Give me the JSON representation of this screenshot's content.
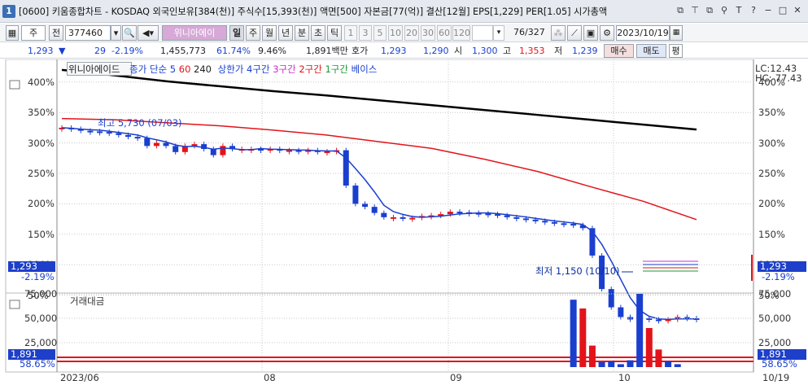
{
  "window": {
    "number": "1",
    "title": "[0600] 키움종합차트 - KOSDAQ 외국인보유[384(천)] 주식수[15,393(천)] 액면[500] 자본금[77(억)] 결산[12월] EPS[1,229] PER[1.05] 시가총액"
  },
  "toolbar": {
    "period": "주",
    "stock_code": "377460",
    "stock_name": "위니아에이",
    "tabs": [
      "일",
      "주",
      "월",
      "년",
      "분",
      "초",
      "틱"
    ],
    "numbers": [
      "1",
      "3",
      "5",
      "10",
      "20",
      "30",
      "60",
      "120"
    ],
    "page": "76",
    "page_total": "/327",
    "date": "2023/10/19"
  },
  "quote": {
    "price": "1,293",
    "change": "29",
    "change_pct": "-2.19%",
    "volume": "1,455,773",
    "vol_ratio": "61.74%",
    "turnover_rate": "9.46%",
    "amount": "1,891백만",
    "hoga_label": "호가",
    "ask": "1,293",
    "bid": "1,290",
    "open_label": "시",
    "open": "1,300",
    "high_label": "고",
    "high": "1,353",
    "low_label": "저",
    "low": "1,239",
    "buy_label": "매수",
    "sell_label": "매도",
    "eval_label": "평"
  },
  "legend": {
    "name": "위니아에이드",
    "items": [
      "종가 단순 5",
      "60",
      "240",
      "상한가 4구간",
      "3구간",
      "2구간",
      "1구간",
      "베이스"
    ]
  },
  "chart_data": {
    "type": "candlestick",
    "y_axis_label": "%",
    "y_ticks": [
      "400%",
      "350%",
      "300%",
      "250%",
      "200%",
      "150%",
      "100%",
      "50%"
    ],
    "price_label": "1,293",
    "price_pct": "-2.19%",
    "lc": "LC:12.43",
    "hc": "HC:-77.43",
    "annotation_high": "최고 5,730 (07/03)",
    "annotation_low": "최저 1,150 (10/10)",
    "x_labels": [
      "2023/06",
      "08",
      "09",
      "10",
      "10/19"
    ],
    "ma240": [
      420,
      411,
      401,
      393,
      385,
      378,
      370,
      362,
      354,
      346,
      338,
      330,
      322
    ],
    "ma60": [
      340,
      338,
      333,
      328,
      321,
      313,
      302,
      291,
      273,
      253,
      228,
      204,
      174
    ],
    "closes": [
      325,
      323,
      320,
      319,
      318,
      316,
      313,
      310,
      308,
      295,
      300,
      295,
      285,
      295,
      298,
      290,
      280,
      295,
      290,
      290,
      290,
      289,
      290,
      288,
      288,
      287,
      288,
      285,
      286,
      288,
      230,
      200,
      195,
      185,
      178,
      178,
      177,
      177,
      180,
      181,
      183,
      187,
      186,
      185,
      184,
      183,
      181,
      178,
      176,
      174,
      172,
      170,
      168,
      167,
      165,
      160,
      115,
      60,
      30,
      14,
      10,
      12,
      10,
      9,
      10,
      14,
      12,
      10
    ],
    "volume": {
      "title": "거래대금",
      "y_ticks": [
        "75,000",
        "50,000",
        "25,000"
      ],
      "price_label": "1,891",
      "pct": "58.65%",
      "bars": [
        {
          "i": 54,
          "v": 69000,
          "c": "blue"
        },
        {
          "i": 55,
          "v": 60000,
          "c": "red"
        },
        {
          "i": 56,
          "v": 22000,
          "c": "red"
        },
        {
          "i": 57,
          "v": 5000,
          "c": "blue"
        },
        {
          "i": 58,
          "v": 6000,
          "c": "blue"
        },
        {
          "i": 59,
          "v": 3000,
          "c": "blue"
        },
        {
          "i": 60,
          "v": 7000,
          "c": "blue"
        },
        {
          "i": 61,
          "v": 75000,
          "c": "blue"
        },
        {
          "i": 62,
          "v": 40000,
          "c": "red"
        },
        {
          "i": 63,
          "v": 18000,
          "c": "red"
        },
        {
          "i": 64,
          "v": 6000,
          "c": "blue"
        },
        {
          "i": 65,
          "v": 3000,
          "c": "blue"
        }
      ]
    }
  }
}
